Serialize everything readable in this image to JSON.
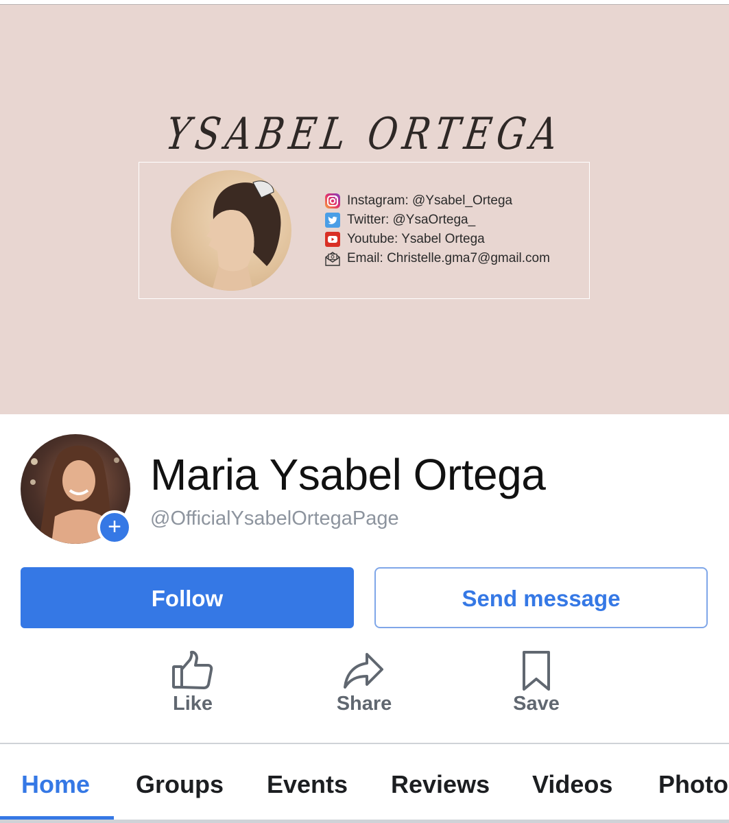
{
  "cover": {
    "title": "YSABEL ORTEGA",
    "contacts": [
      {
        "icon": "instagram-icon",
        "text": "Instagram: @Ysabel_Ortega"
      },
      {
        "icon": "twitter-icon",
        "text": "Twitter: @YsaOrtega_"
      },
      {
        "icon": "youtube-icon",
        "text": "Youtube: Ysabel Ortega"
      },
      {
        "icon": "email-icon",
        "text": "Email: Christelle.gma7@gmail.com"
      }
    ]
  },
  "profile": {
    "name": "Maria Ysabel Ortega",
    "handle": "@OfficialYsabelOrtegaPage",
    "badge": "+"
  },
  "buttons": {
    "follow": "Follow",
    "message": "Send message"
  },
  "actions": {
    "like": "Like",
    "share": "Share",
    "save": "Save"
  },
  "tabs": [
    "Home",
    "Groups",
    "Events",
    "Reviews",
    "Videos",
    "Photo"
  ],
  "active_tab": "Home",
  "colors": {
    "accent": "#3578e5",
    "cover_bg": "#e8d6d1",
    "muted": "#606770"
  }
}
